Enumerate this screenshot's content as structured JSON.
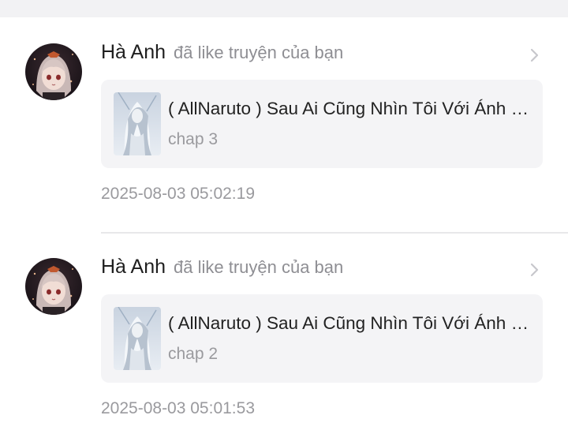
{
  "notifications": [
    {
      "user_name": "Hà Anh",
      "action": "đã like truyện của bạn",
      "story_title": "( AllNaruto ) Sau Ai Cũng Nhìn Tôi Với Ánh Mắt",
      "chapter": "chap 3",
      "timestamp": "2025-08-03 05:02:19"
    },
    {
      "user_name": "Hà Anh",
      "action": "đã like truyện của bạn",
      "story_title": "( AllNaruto ) Sau Ai Cũng Nhìn Tôi Với Ánh Mắt",
      "chapter": "chap 2",
      "timestamp": "2025-08-03 05:01:53"
    }
  ],
  "icons": {
    "chevron": "chevron-right-icon"
  },
  "colors": {
    "text_primary": "#1f1f1f",
    "text_secondary": "#9a9a9e",
    "card_background": "#f4f4f6",
    "top_band": "#f2f2f4"
  }
}
